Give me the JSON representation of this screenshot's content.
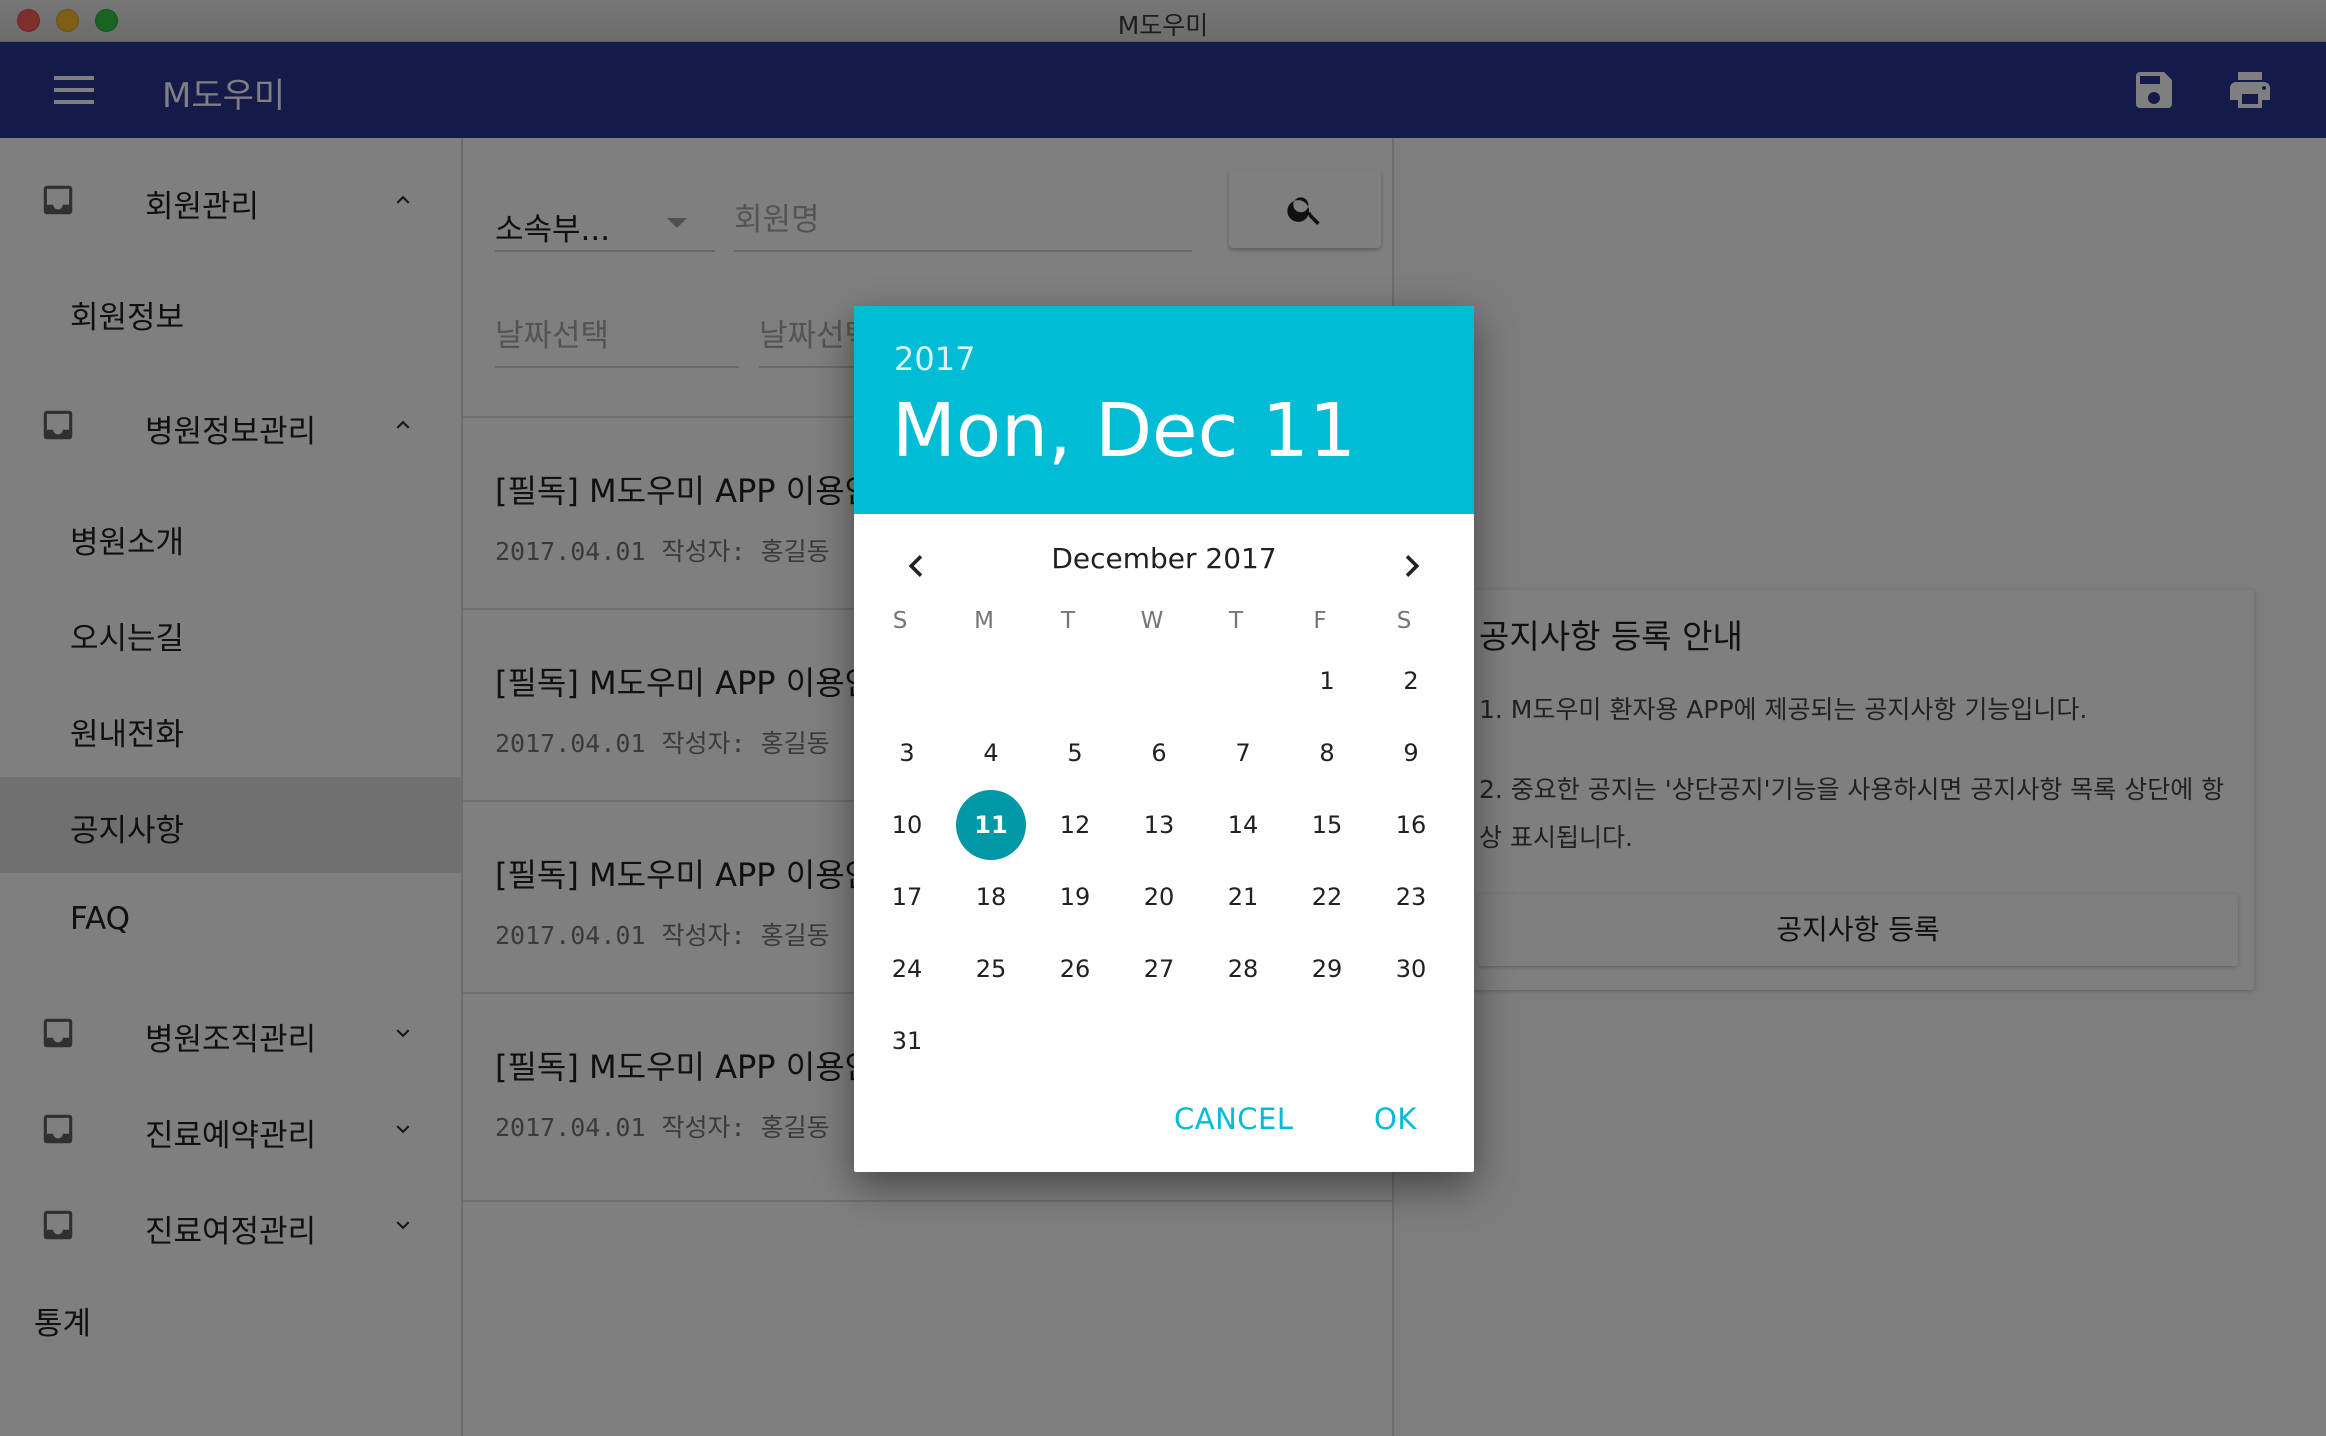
{
  "window": {
    "title": "M도우미"
  },
  "appbar": {
    "title": "M도우미",
    "menu_icon": "hamburger-icon",
    "save_icon": "save-icon",
    "print_icon": "print-icon"
  },
  "sidebar": {
    "groups": [
      {
        "label": "회원관리",
        "expanded": true,
        "items": [
          "회원정보"
        ]
      },
      {
        "label": "병원정보관리",
        "expanded": true,
        "items": [
          "병원소개",
          "오시는길",
          "원내전화",
          "공지사항",
          "FAQ"
        ]
      },
      {
        "label": "병원조직관리",
        "expanded": false
      },
      {
        "label": "진료예약관리",
        "expanded": false
      },
      {
        "label": "진료여정관리",
        "expanded": false
      }
    ],
    "active_item": "공지사항",
    "stats": "통계"
  },
  "filters": {
    "department": "소속부...",
    "member_placeholder": "회원명",
    "date_from_placeholder": "날짜선택",
    "date_to_placeholder": "날짜선택"
  },
  "notices": [
    {
      "title": "[필독] M도우미 APP 이용안내",
      "date": "2017.04.01",
      "author": "작성자: 홍길동"
    },
    {
      "title": "[필독] M도우미 APP 이용안내",
      "date": "2017.04.01",
      "author": "작성자: 홍길동"
    },
    {
      "title": "[필독] M도우미 APP 이용안내",
      "date": "2017.04.01",
      "author": "작성자: 홍길동"
    },
    {
      "title": "[필독] M도우미 APP 이용안내",
      "date": "2017.04.01",
      "author": "작성자: 홍길동"
    }
  ],
  "info_card": {
    "title": "공지사항 등록 안내",
    "line1": "1. M도우미 환자용 APP에 제공되는 공지사항 기능입니다.",
    "line2": "2. 중요한 공지는 '상단공지'기능을 사용하시면 공지사항 목록 상단에 항상 표시됩니다.",
    "button": "공지사항 등록"
  },
  "date_picker": {
    "year": "2017",
    "selected_label": "Mon, Dec 11",
    "month_label": "December 2017",
    "weekdays": [
      "S",
      "M",
      "T",
      "W",
      "T",
      "F",
      "S"
    ],
    "first_weekday_index": 5,
    "days_in_month": 31,
    "selected_day": 11,
    "cancel": "CANCEL",
    "ok": "OK",
    "accent_color": "#00bcd4",
    "selected_color": "#0097a7"
  }
}
